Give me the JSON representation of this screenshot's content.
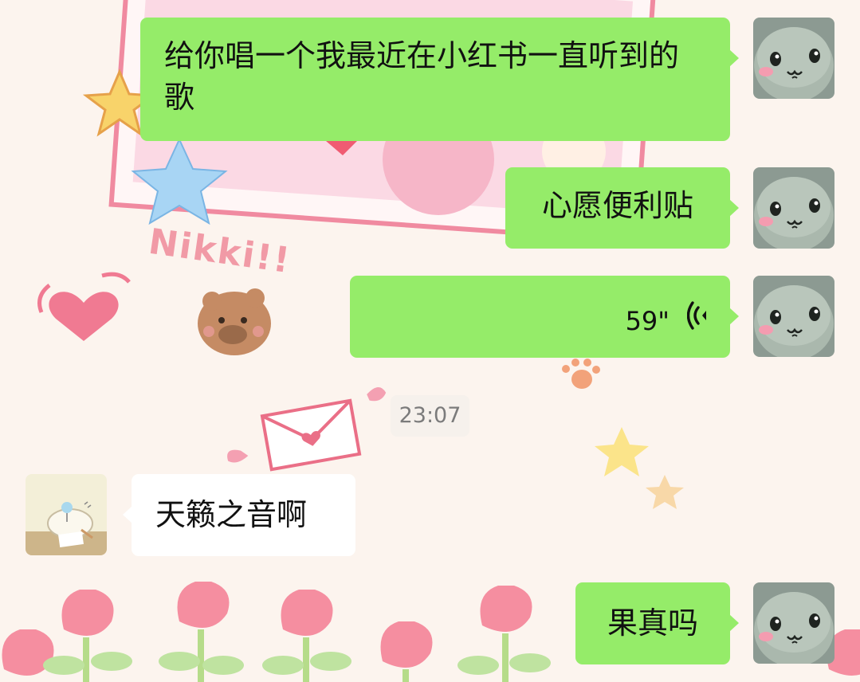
{
  "messages": [
    {
      "id": "m1",
      "side": "me",
      "text": "给你唱一个我最近在小红书一直听到的歌"
    },
    {
      "id": "m2",
      "side": "me",
      "text": "心愿便利贴"
    },
    {
      "id": "m3",
      "side": "me",
      "type": "voice",
      "duration": "59\""
    },
    {
      "id": "m4",
      "side": "other",
      "text": "天籁之音啊"
    },
    {
      "id": "m5",
      "side": "me",
      "text": "果真吗"
    }
  ],
  "timestamp": "23:07",
  "wallpaper_text": "Nikki!!",
  "colors": {
    "my_bubble": "#95ec69",
    "their_bubble": "#ffffff",
    "timestamp_text": "#7b7b7b"
  },
  "icons": {
    "voice": "voice-wave-icon",
    "my_avatar": "green-blob-avatar",
    "their_avatar": "lamp-desk-avatar"
  }
}
